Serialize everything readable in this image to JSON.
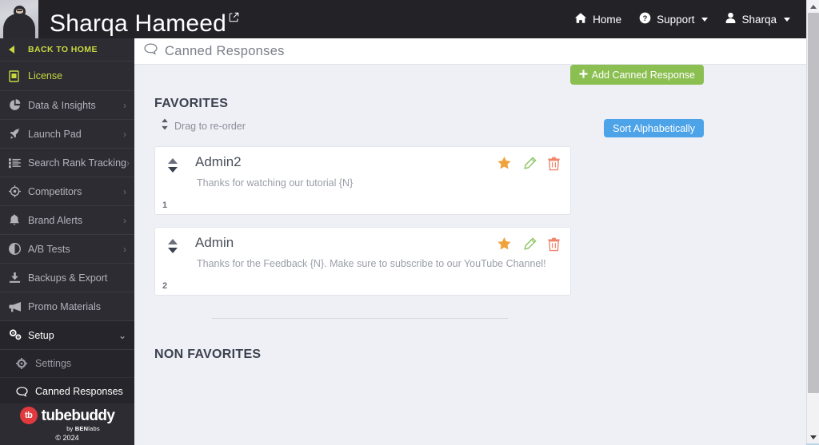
{
  "topbar": {
    "channel_title": "Sharqa Hameed",
    "external_link_icon": "external-link-icon",
    "avatar_icon": "user-avatar-photo",
    "nav": [
      {
        "label": "Home",
        "icon": "home-icon",
        "caret": false
      },
      {
        "label": "Support",
        "icon": "question-circle-icon",
        "caret": true
      },
      {
        "label": "Sharqa",
        "icon": "user-icon",
        "caret": true
      }
    ]
  },
  "sidebar": {
    "back_label": "BACK TO HOME",
    "back_icon": "caret-left-icon",
    "items": [
      {
        "label": "License",
        "icon": "file-certificate-icon",
        "chevron": "",
        "active": false
      },
      {
        "label": "Data & Insights",
        "icon": "pie-chart-icon",
        "chevron": "›",
        "active": false
      },
      {
        "label": "Launch Pad",
        "icon": "rocket-icon",
        "chevron": "›",
        "active": false
      },
      {
        "label": "Search Rank Tracking",
        "icon": "list-ol-icon",
        "chevron": "›",
        "active": false
      },
      {
        "label": "Competitors",
        "icon": "crosshairs-icon",
        "chevron": "›",
        "active": false
      },
      {
        "label": "Brand Alerts",
        "icon": "bell-icon",
        "chevron": "›",
        "active": false
      },
      {
        "label": "A/B Tests",
        "icon": "adjust-circle-icon",
        "chevron": "›",
        "active": false
      },
      {
        "label": "Backups & Export",
        "icon": "download-icon",
        "chevron": "",
        "active": false
      },
      {
        "label": "Promo Materials",
        "icon": "bullhorn-icon",
        "chevron": "",
        "active": false
      }
    ],
    "setup": {
      "label": "Setup",
      "icon": "gears-icon",
      "chevron": "⌄",
      "children": [
        {
          "label": "Settings",
          "icon": "gear-icon",
          "active": false
        },
        {
          "label": "Canned Responses",
          "icon": "comment-icon",
          "active": true
        }
      ]
    },
    "logo": {
      "badge": "tb",
      "wordmark": "tubebuddy",
      "byline_prefix": "by ",
      "byline_brand": "BEN",
      "byline_suffix": "labs",
      "copyright": "© 2024"
    }
  },
  "content": {
    "header": {
      "title": "Canned Responses",
      "icon": "comment-icon"
    },
    "add_button": {
      "label": "Add Canned Response",
      "icon": "plus-icon",
      "color": "#8cbf52"
    },
    "favorites_heading": "FAVORITES",
    "reorder_label": "Drag to re-order",
    "reorder_icon": "sort-updown-icon",
    "sort_button": {
      "label": "Sort Alphabetically",
      "color": "#4da3e8"
    },
    "cards": [
      {
        "title": "Admin2",
        "text": "Thanks for watching our tutorial {N}",
        "index": "1",
        "star_icon": "star-filled-icon",
        "edit_icon": "pencil-icon",
        "delete_icon": "trash-icon",
        "star_color": "#f0a33c",
        "edit_color": "#8cc665",
        "delete_color": "#f0846a"
      },
      {
        "title": "Admin",
        "text": "Thanks for the Feedback {N}. Make sure to subscribe to our YouTube Channel!",
        "index": "2",
        "star_icon": "star-filled-icon",
        "edit_icon": "pencil-icon",
        "delete_icon": "trash-icon",
        "star_color": "#f0a33c",
        "edit_color": "#8cc665",
        "delete_color": "#f0846a"
      }
    ],
    "nonfavorites_heading": "NON FAVORITES"
  },
  "scrollbar": {
    "up_icon": "scroll-up-arrow-icon",
    "down_icon": "scroll-down-arrow-icon"
  }
}
